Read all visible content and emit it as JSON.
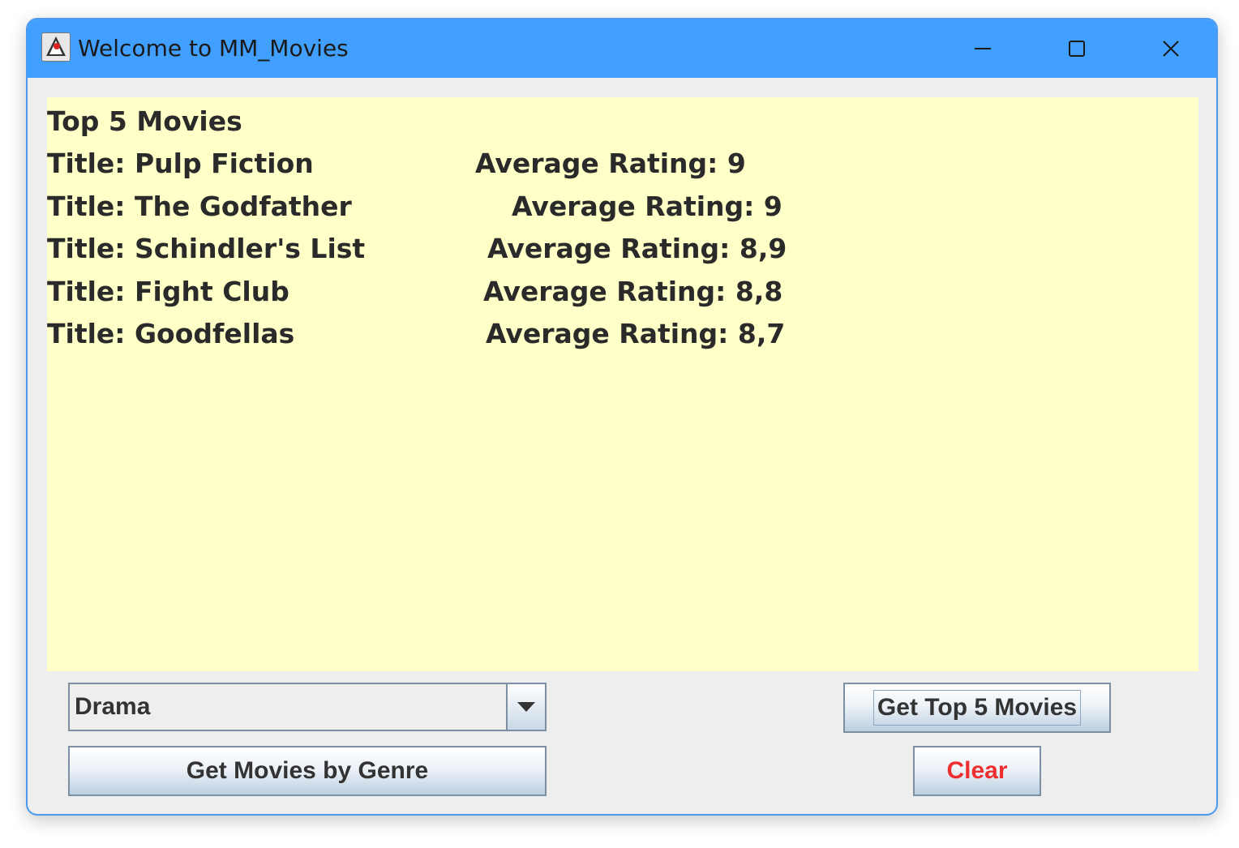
{
  "window": {
    "title": "Welcome to MM_Movies"
  },
  "output": {
    "heading": "Top 5 Movies",
    "movies": [
      {
        "title": "Title: Pulp Fiction",
        "rating": "Average Rating: 9"
      },
      {
        "title": "Title: The Godfather",
        "rating": "Average Rating: 9"
      },
      {
        "title": "Title: Schindler's List",
        "rating": "Average Rating: 8,9"
      },
      {
        "title": "Title: Fight Club",
        "rating": "Average Rating: 8,8"
      },
      {
        "title": "Title: Goodfellas",
        "rating": "Average Rating: 8,7"
      }
    ]
  },
  "controls": {
    "genre_selected": "Drama",
    "genre_button": "Get Movies by Genre",
    "top5_button": "Get Top 5 Movies",
    "clear_button": "Clear"
  },
  "colors": {
    "titlebar": "#41a0ff",
    "textarea_bg": "#ffffc8",
    "clear_text": "#ef2f2f"
  },
  "icons": {
    "app": "java-duke-icon",
    "minimize": "minimize-icon",
    "maximize": "maximize-icon",
    "close": "close-icon",
    "dropdown": "chevron-down-icon"
  }
}
